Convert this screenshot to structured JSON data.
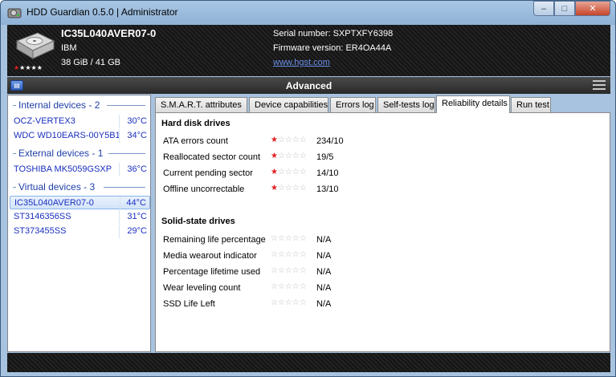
{
  "window": {
    "title": "HDD Guardian 0.5.0 | Administrator",
    "controls": {
      "minimize": "–",
      "maximize": "□",
      "close": "✕"
    }
  },
  "header": {
    "model": "IC35L040AVER07-0",
    "brand": "IBM",
    "size": "38 GiB / 41 GB",
    "serial": "Serial number: SXPTXFY6398",
    "firmware": "Firmware version: ER4OA44A",
    "link": "www.hgst.com",
    "rating": {
      "filled": 1,
      "total": 5
    }
  },
  "advanced_bar": {
    "title": "Advanced",
    "left_icon": "drive-icon",
    "right_icon": "menu-icon"
  },
  "sidebar": {
    "groups": [
      {
        "title": "Internal devices - 2",
        "devices": [
          {
            "name": "OCZ-VERTEX3",
            "temp": "30°C"
          },
          {
            "name": "WDC WD10EARS-00Y5B1",
            "temp": "34°C"
          }
        ]
      },
      {
        "title": "External devices - 1",
        "devices": [
          {
            "name": "TOSHIBA MK5059GSXP",
            "temp": "36°C"
          }
        ]
      },
      {
        "title": "Virtual devices - 3",
        "devices": [
          {
            "name": "IC35L040AVER07-0",
            "temp": "44°C",
            "selected": true
          },
          {
            "name": "ST3146356SS",
            "temp": "31°C"
          },
          {
            "name": "ST373455SS",
            "temp": "29°C"
          }
        ]
      }
    ]
  },
  "tabs": [
    {
      "label": "S.M.A.R.T. attributes"
    },
    {
      "label": "Device capabilities"
    },
    {
      "label": "Errors log"
    },
    {
      "label": "Self-tests log"
    },
    {
      "label": "Reliability details",
      "active": true
    },
    {
      "label": "Run test"
    }
  ],
  "reliability": {
    "hdd_title": "Hard disk drives",
    "hdd_rows": [
      {
        "label": "ATA errors count",
        "stars": 1,
        "value": "234/10"
      },
      {
        "label": "Reallocated sector count",
        "stars": 1,
        "value": "19/5"
      },
      {
        "label": "Current pending sector",
        "stars": 1,
        "value": "14/10"
      },
      {
        "label": "Offline uncorrectable",
        "stars": 1,
        "value": "13/10"
      }
    ],
    "ssd_title": "Solid-state drives",
    "ssd_rows": [
      {
        "label": "Remaining life percentage",
        "stars": 0,
        "value": "N/A"
      },
      {
        "label": "Media wearout indicator",
        "stars": 0,
        "value": "N/A"
      },
      {
        "label": "Percentage lifetime used",
        "stars": 0,
        "value": "N/A"
      },
      {
        "label": "Wear leveling count",
        "stars": 0,
        "value": "N/A"
      },
      {
        "label": "SSD Life Left",
        "stars": 0,
        "value": "N/A"
      }
    ]
  },
  "colors": {
    "link": "#6a8fe8",
    "device_text": "#1a2fbe",
    "group_text": "#1e3fa8",
    "star_bad": "#e02020"
  }
}
